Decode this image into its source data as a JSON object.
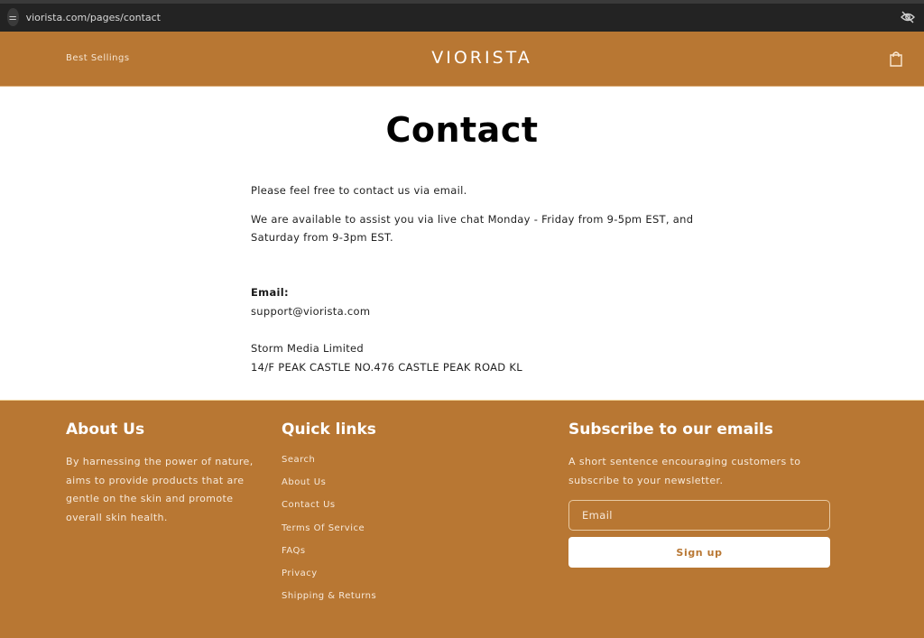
{
  "browser": {
    "url": "viorista.com/pages/contact",
    "site_info_icon": "tune-icon",
    "privacy_icon": "eye-off-icon"
  },
  "header": {
    "nav_link": "Best Sellings",
    "logo": "VIORISTA",
    "cart_icon": "shopping-bag-icon"
  },
  "main": {
    "title": "Contact",
    "intro": "Please feel free to contact us via email.",
    "availability": "We are available to assist you via live chat Monday - Friday from 9-5pm EST, and Saturday from 9-3pm EST.",
    "email_label": "Email:",
    "email": "support@viorista.com",
    "company": "Storm Media Limited",
    "address": "14/F PEAK CASTLE NO.476 CASTLE PEAK ROAD KL"
  },
  "footer": {
    "about": {
      "heading": "About Us",
      "text": "By harnessing the power of nature, aims to provide products that are gentle on the skin and promote overall skin health."
    },
    "quick_links": {
      "heading": "Quick links",
      "items": [
        "Search",
        "About Us",
        "Contact Us",
        "Terms Of Service",
        "FAQs",
        "Privacy",
        "Shipping & Returns"
      ]
    },
    "subscribe": {
      "heading": "Subscribe to our emails",
      "text": "A short sentence encouraging customers to subscribe to your newsletter.",
      "email_placeholder": "Email",
      "email_value": "",
      "button": "Sign up"
    }
  },
  "colors": {
    "brand": "#b87733",
    "footer_text": "#f7e9da",
    "browser_bar": "#232323"
  }
}
